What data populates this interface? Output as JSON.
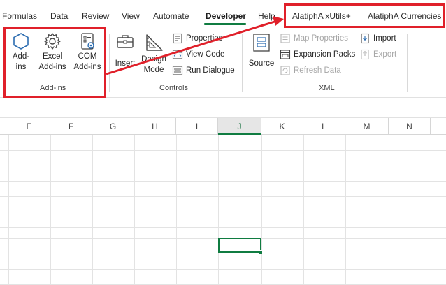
{
  "tabs": [
    "Formulas",
    "Data",
    "Review",
    "View",
    "Automate",
    "Developer",
    "Help",
    "AlatiphA xUtils+",
    "AlatiphA Currencies"
  ],
  "active_tab": "Developer",
  "ribbon": {
    "addins": {
      "add_ins_line1": "Add-",
      "add_ins_line2": "ins",
      "excel_line1": "Excel",
      "excel_line2": "Add-ins",
      "com_line1": "COM",
      "com_line2": "Add-ins",
      "group_label": "Add-ins"
    },
    "controls": {
      "insert": "Insert",
      "design_line1": "Design",
      "design_line2": "Mode",
      "properties": "Properties",
      "view_code": "View Code",
      "run_dialogue": "Run Dialogue",
      "group_label": "Controls"
    },
    "xml": {
      "source": "Source",
      "map_properties": "Map Properties",
      "expansion_packs": "Expansion Packs",
      "refresh_data": "Refresh Data",
      "import": "Import",
      "export": "Export",
      "group_label": "XML"
    }
  },
  "grid": {
    "columns": [
      "E",
      "F",
      "G",
      "H",
      "I",
      "J",
      "K",
      "L",
      "M",
      "N"
    ],
    "selected_column": "J"
  },
  "colors": {
    "accent": "#107c41",
    "highlight": "#e0202a",
    "disabled": "#a6a6a6"
  }
}
